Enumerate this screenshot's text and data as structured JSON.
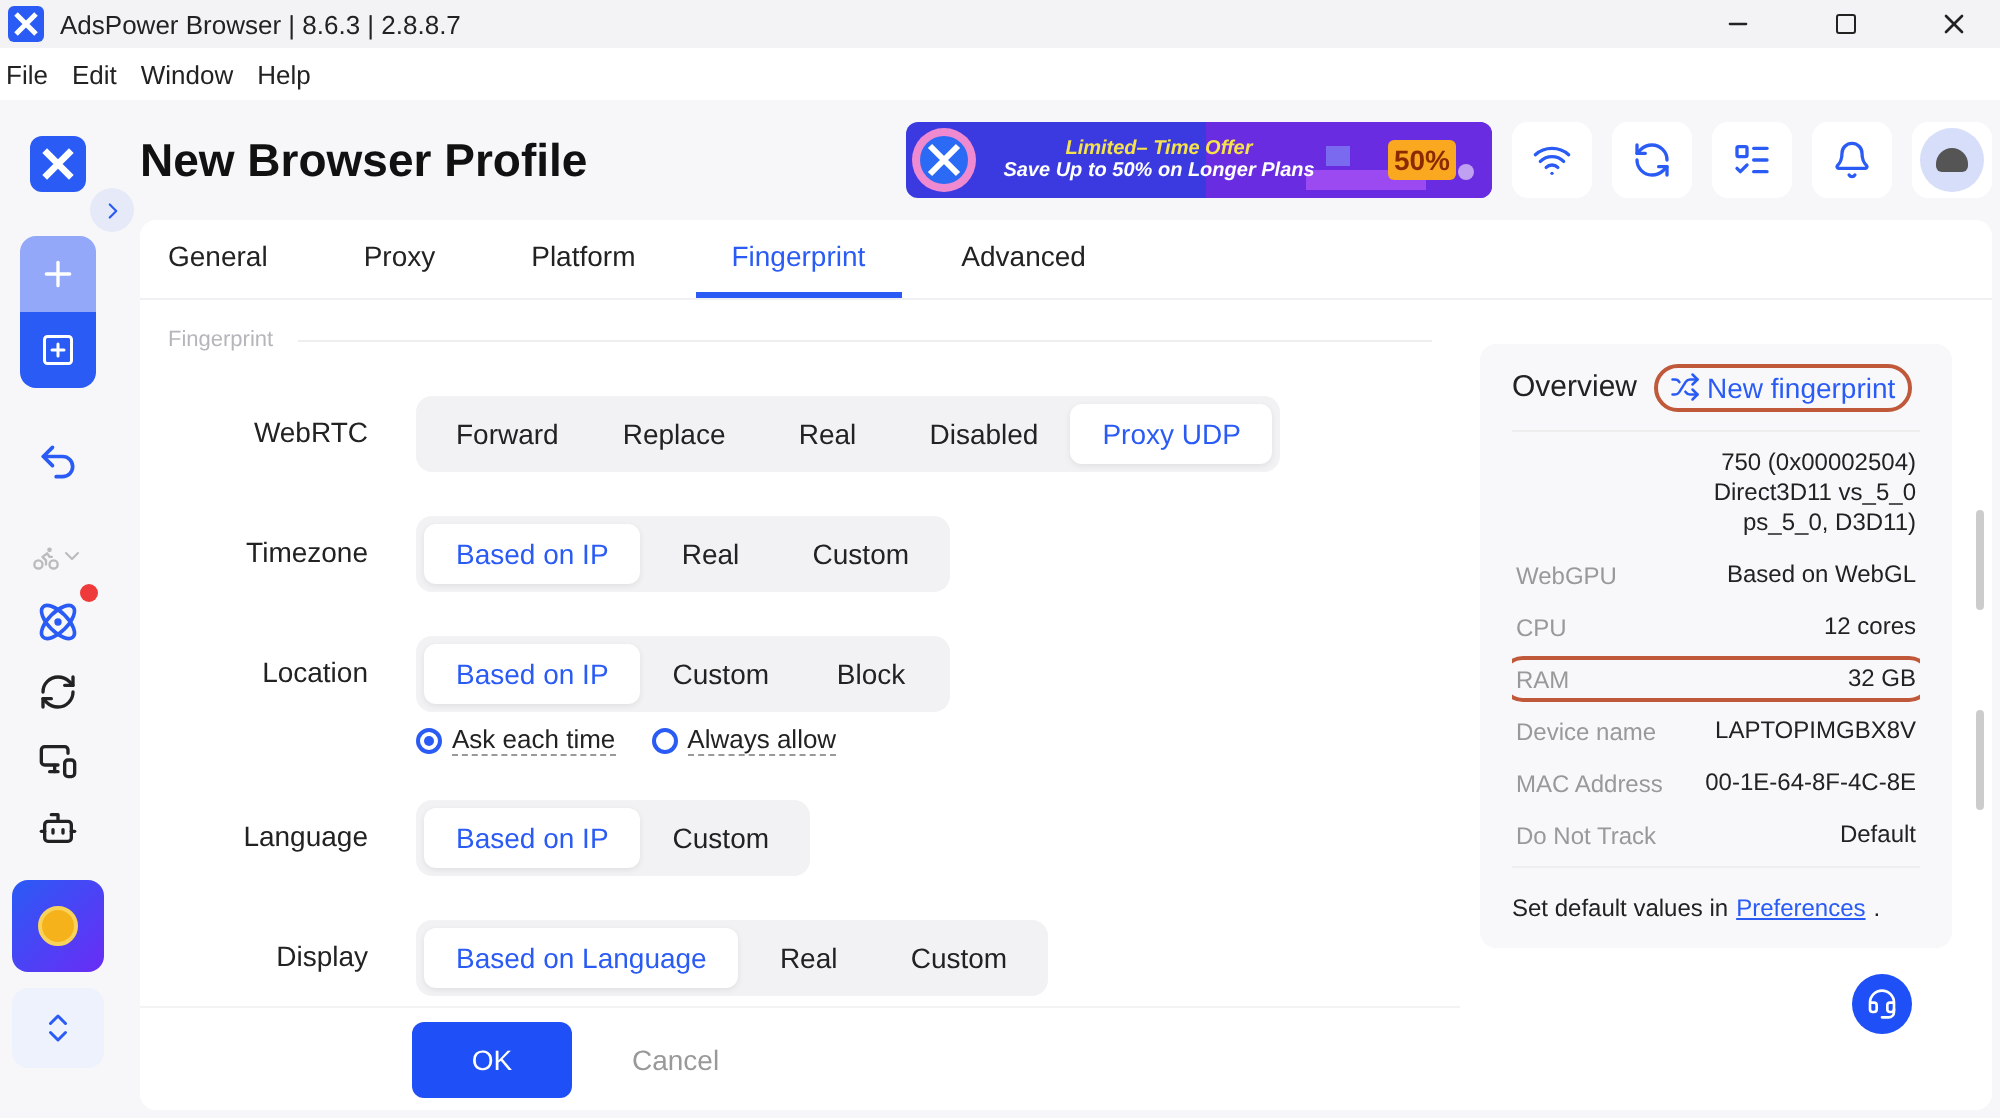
{
  "window": {
    "title": "AdsPower Browser | 8.6.3 | 2.8.8.7"
  },
  "menu": [
    "File",
    "Edit",
    "Window",
    "Help"
  ],
  "page_title": "New Browser Profile",
  "banner": {
    "kind": "picture",
    "line_1": "Limited– Time Offer",
    "line_2": "Save Up to 50% on Longer Plans",
    "badge": "50%"
  },
  "tabs": [
    {
      "label": "General",
      "selected": false
    },
    {
      "label": "Proxy",
      "selected": false
    },
    {
      "label": "Platform",
      "selected": false
    },
    {
      "label": "Fingerprint",
      "selected": true
    },
    {
      "label": "Advanced",
      "selected": false
    }
  ],
  "section_title": "Fingerprint",
  "fields": [
    {
      "label": "WebRTC",
      "options": [
        {
          "label": "Forward",
          "selected": false
        },
        {
          "label": "Replace",
          "selected": false
        },
        {
          "label": "Real",
          "selected": false
        },
        {
          "label": "Disabled",
          "selected": false
        },
        {
          "label": "Proxy UDP",
          "selected": true
        }
      ]
    },
    {
      "label": "Timezone",
      "options": [
        {
          "label": "Based on IP",
          "selected": true
        },
        {
          "label": "Real",
          "selected": false
        },
        {
          "label": "Custom",
          "selected": false
        }
      ]
    },
    {
      "label": "Location",
      "options": [
        {
          "label": "Based on IP",
          "selected": true
        },
        {
          "label": "Custom",
          "selected": false
        },
        {
          "label": "Block",
          "selected": false
        }
      ],
      "radios": [
        {
          "label": "Ask each time",
          "selected": true
        },
        {
          "label": "Always allow",
          "selected": false
        }
      ]
    },
    {
      "label": "Language",
      "options": [
        {
          "label": "Based on IP",
          "selected": true
        },
        {
          "label": "Custom",
          "selected": false
        }
      ]
    },
    {
      "label": "Display",
      "options": [
        {
          "label": "Based on Language",
          "selected": true
        },
        {
          "label": "Real",
          "selected": false
        },
        {
          "label": "Custom",
          "selected": false
        }
      ]
    }
  ],
  "buttons": {
    "ok": "OK",
    "cancel": "Cancel"
  },
  "overview": {
    "title": "Overview",
    "new_fingerprint": {
      "label": "New fingerprint",
      "highlighted": true
    },
    "rows": [
      {
        "value": "750 (0x00002504) Direct3D11 vs_5_0 ps_5_0, D3D11)",
        "highlighted": false
      },
      {
        "label": "WebGPU",
        "value": "Based on WebGL",
        "highlighted": false
      },
      {
        "label": "CPU",
        "value": "12 cores",
        "highlighted": false
      },
      {
        "label": "RAM",
        "value": "32 GB",
        "highlighted": true
      },
      {
        "label": "Device name",
        "value": "LAPTOPIMGBX8V",
        "highlighted": false
      },
      {
        "label": "MAC Address",
        "value": "00-1E-64-8F-4C-8E",
        "highlighted": false
      },
      {
        "label": "Do Not Track",
        "value": "Default",
        "highlighted": false
      }
    ],
    "footer_text": "Set default values in",
    "footer_link": "Preferences",
    "footer_end": "."
  }
}
